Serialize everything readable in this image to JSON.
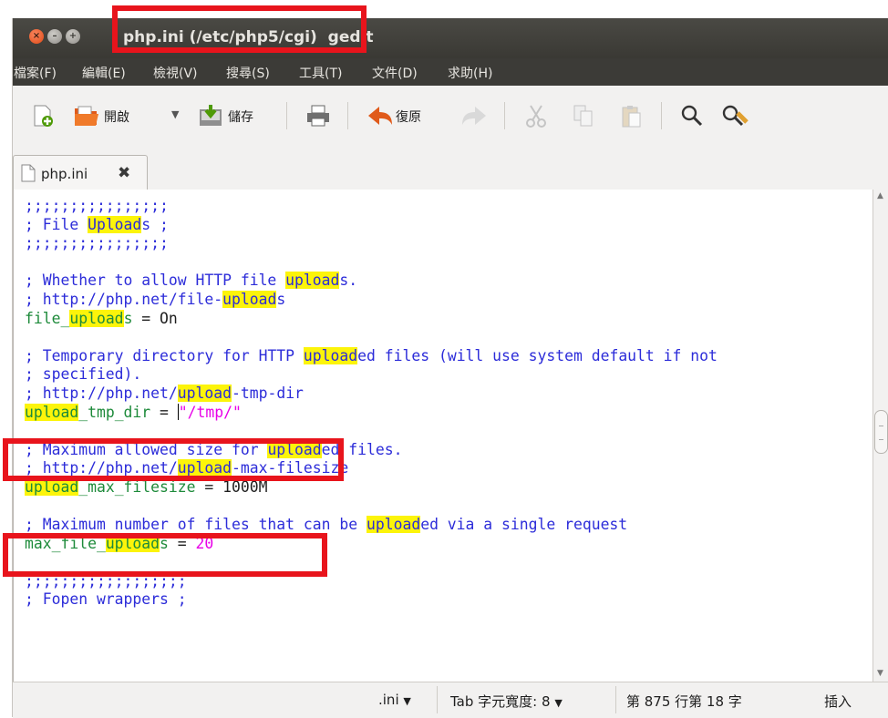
{
  "window": {
    "title": "php.ini (/etc/php5/cgi)  gedit",
    "close_glyph": "×",
    "min_glyph": "–",
    "max_glyph": "+"
  },
  "menubar": {
    "items": [
      {
        "label": "檔案(F)"
      },
      {
        "label": "編輯(E)"
      },
      {
        "label": "檢視(V)"
      },
      {
        "label": "搜尋(S)"
      },
      {
        "label": "工具(T)"
      },
      {
        "label": "文件(D)"
      },
      {
        "label": "求助(H)"
      }
    ]
  },
  "toolbar": {
    "open_label": "開啟",
    "open_dropdown_glyph": "▼",
    "save_label": "儲存",
    "revert_label": "復原"
  },
  "tab": {
    "label": "php.ini",
    "close_glyph": "✖"
  },
  "editor": {
    "lines": [
      ";;;;;;;;;;;;;;;;",
      "; File Uploads ;",
      ";;;;;;;;;;;;;;;;",
      "",
      "; Whether to allow HTTP file uploads.",
      "; http://php.net/file-uploads",
      "file_uploads = On",
      "",
      "; Temporary directory for HTTP uploaded files (will use system default if not",
      "; specified).",
      "; http://php.net/upload-tmp-dir",
      "upload_tmp_dir = \"/tmp/\"",
      "",
      "; Maximum allowed size for uploaded files.",
      "; http://php.net/upload-max-filesize",
      "upload_max_filesize = 1000M",
      "",
      "; Maximum number of files that can be uploaded via a single request",
      "max_file_uploads = 20",
      "",
      ";;;;;;;;;;;;;;;;;;",
      "; Fopen wrappers ;"
    ]
  },
  "statusbar": {
    "language": ".ini",
    "language_dropdown": "▼",
    "tab_width": "Tab 字元寬度: 8",
    "tab_width_dropdown": "▼",
    "position": "第 875 行第 18 字",
    "mode": "插入"
  },
  "colors": {
    "highlight": "#fcf40a",
    "comment": "#2c2cd9",
    "key": "#1d8a3a",
    "value": "#e800e8",
    "annotation_box": "#e8141c"
  }
}
